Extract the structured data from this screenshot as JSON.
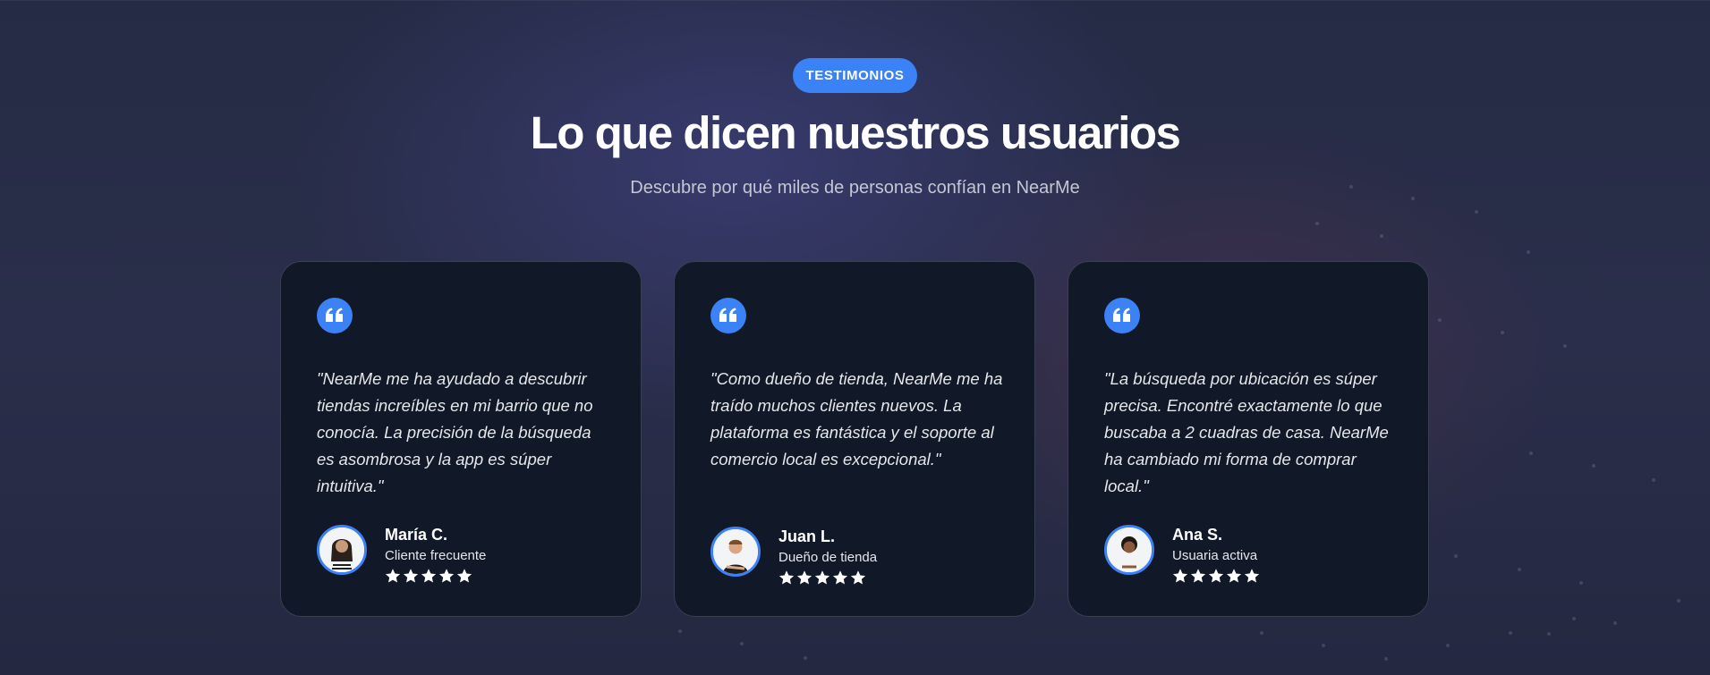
{
  "section": {
    "badge": "TESTIMONIOS",
    "title": "Lo que dicen nuestros usuarios",
    "subtitle": "Descubre por qué miles de personas confían en NearMe"
  },
  "colors": {
    "accent": "#3b82f6",
    "card_bg": "#111827",
    "card_border": "#374151",
    "text_primary": "#ffffff",
    "text_secondary": "#e5e7eb"
  },
  "testimonials": [
    {
      "quote": "\"NearMe me ha ayudado a descubrir tiendas increíbles en mi barrio que no conocía. La precisión de la búsqueda es asombrosa y la app es súper intuitiva.\"",
      "name": "María C.",
      "role": "Cliente frecuente",
      "rating": 5,
      "icon": "quote-icon",
      "avatar": "woman-avatar"
    },
    {
      "quote": "\"Como dueño de tienda, NearMe me ha traído muchos clientes nuevos. La plataforma es fantástica y el soporte al comercio local es excepcional.\"",
      "name": "Juan L.",
      "role": "Dueño de tienda",
      "rating": 5,
      "icon": "quote-icon",
      "avatar": "man-avatar"
    },
    {
      "quote": "\"La búsqueda por ubicación es súper precisa. Encontré exactamente lo que buscaba a 2 cuadras de casa. NearMe ha cambiado mi forma de comprar local.\"",
      "name": "Ana S.",
      "role": "Usuaria activa",
      "rating": 5,
      "icon": "quote-icon",
      "avatar": "woman-avatar"
    }
  ]
}
